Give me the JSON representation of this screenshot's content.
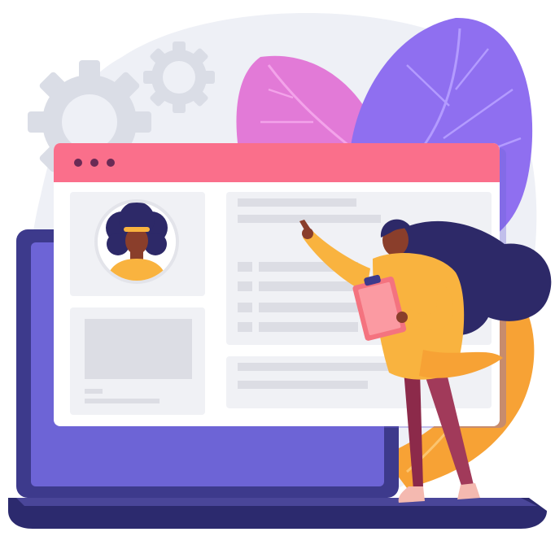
{
  "illustration": {
    "subject": "",
    "colors": {
      "background_blob": "#eef0f6",
      "gear": "#dadde6",
      "laptop_frame": "#3d3a8c",
      "laptop_screen": "#6d64d6",
      "laptop_base": "#2c2a6e",
      "browser_bar": "#fa6f8b",
      "browser_body": "#ffffff",
      "panel": "#f0f1f5",
      "placeholder_block": "#dcdde4",
      "leaf_pink": "#e27ad7",
      "leaf_purple": "#8f6ff0",
      "leaf_orange": "#f7a235",
      "skin": "#8a3e2b",
      "hair": "#2d2968",
      "sweater": "#f9b33f",
      "pants": "#8c2a4a",
      "clipboard": "#f4737f"
    }
  }
}
